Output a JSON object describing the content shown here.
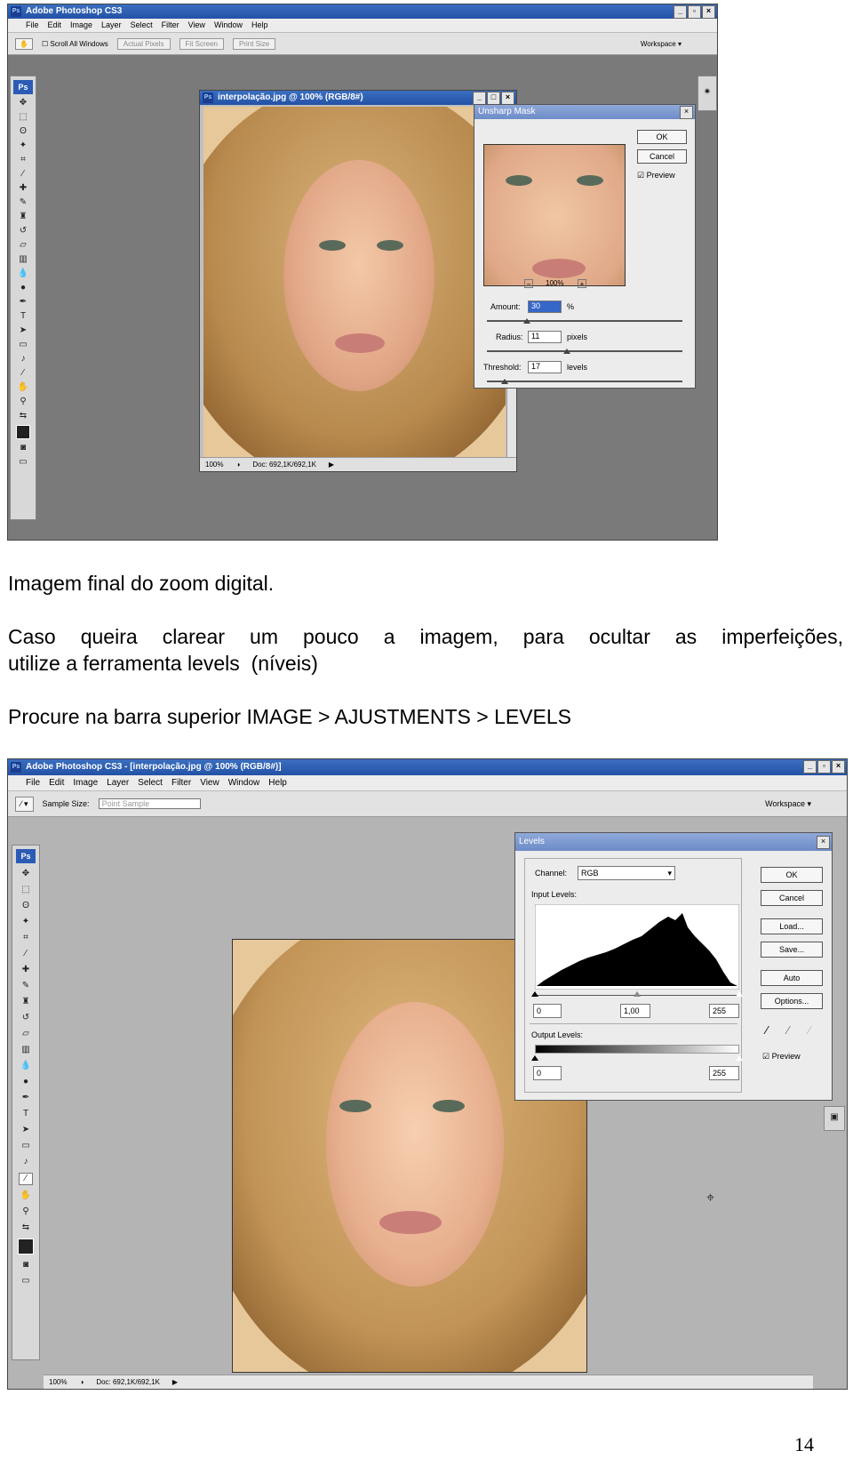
{
  "screen1": {
    "app_title": "Adobe Photoshop CS3",
    "menu": [
      "File",
      "Edit",
      "Image",
      "Layer",
      "Select",
      "Filter",
      "View",
      "Window",
      "Help"
    ],
    "options": {
      "scroll_all": "Scroll All Windows",
      "actual_pixels": "Actual Pixels",
      "fit_screen": "Fit Screen",
      "print_size": "Print Size",
      "workspace": "Workspace ▾"
    },
    "doc_title": "interpolação.jpg @ 100% (RGB/8#)",
    "zoom": "100%",
    "doc_size": "Doc: 692,1K/692,1K",
    "unsharp": {
      "title": "Unsharp Mask",
      "ok": "OK",
      "cancel": "Cancel",
      "preview": "Preview",
      "zoom": "100%",
      "amount_label": "Amount:",
      "amount_value": "30",
      "amount_unit": "%",
      "radius_label": "Radius:",
      "radius_value": "11",
      "radius_unit": "pixels",
      "threshold_label": "Threshold:",
      "threshold_value": "17",
      "threshold_unit": "levels"
    }
  },
  "text": {
    "caption1": "Imagem final do zoom digital.",
    "para1_line1": "Caso queira clarear um pouco a imagem, para ocultar as imperfeições,",
    "para1_line2": "utilize a ferramenta levels  (níveis)",
    "para2": "Procure na barra superior IMAGE > AJUSTMENTS > LEVELS"
  },
  "screen2": {
    "app_title": "Adobe Photoshop CS3 - [interpolação.jpg @ 100% (RGB/8#)]",
    "menu": [
      "File",
      "Edit",
      "Image",
      "Layer",
      "Select",
      "Filter",
      "View",
      "Window",
      "Help"
    ],
    "sample_size_label": "Sample Size:",
    "sample_size_value": "Point Sample",
    "workspace": "Workspace ▾",
    "zoom": "100%",
    "doc_size": "Doc: 692,1K/692,1K",
    "levels": {
      "title": "Levels",
      "channel_label": "Channel:",
      "channel_value": "RGB",
      "input_label": "Input Levels:",
      "input_values": [
        "0",
        "1,00",
        "255"
      ],
      "output_label": "Output Levels:",
      "output_values": [
        "0",
        "255"
      ],
      "buttons": [
        "OK",
        "Cancel",
        "Load...",
        "Save...",
        "Auto",
        "Options..."
      ],
      "preview": "Preview"
    }
  },
  "page_number": "14"
}
